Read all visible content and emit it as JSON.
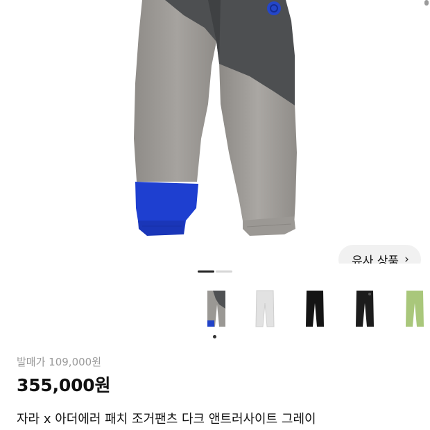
{
  "product": {
    "release_price_label": "발매가 109,000원",
    "price": "355,000원",
    "title": "자라 x 아더에러 패치 조거팬츠 다크 앤트러사이트 그레이"
  },
  "similar_button": {
    "label": "유사 상품",
    "chevron": "›"
  },
  "gallery": {
    "pager": {
      "total": 2,
      "active": 1
    }
  },
  "thumbnails": [
    {
      "name": "gray-patch-joggers",
      "color": "#8c8c8c"
    },
    {
      "name": "white-joggers",
      "color": "#e4e4e4"
    },
    {
      "name": "black-joggers",
      "color": "#1a1a1a"
    },
    {
      "name": "black-joggers-2",
      "color": "#1f1f1f"
    },
    {
      "name": "lime-joggers",
      "color": "#a9c77b"
    }
  ],
  "colors": {
    "pants_gray": "#a3a09c",
    "pants_dark": "#4d4f51",
    "cuff_blue": "#1e3fd0"
  }
}
